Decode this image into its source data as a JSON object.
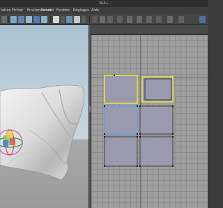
{
  "window": {
    "title": "NULL"
  },
  "menu": {
    "items": [
      {
        "id": "ration",
        "label": "ration"
      },
      {
        "id": "fichier",
        "label": "Fichier"
      },
      {
        "id": "environnement",
        "label": "Environnement"
      },
      {
        "id": "rendu",
        "label": "Rendu"
      },
      {
        "id": "fenetre",
        "label": "Fenêtre"
      },
      {
        "id": "reglages",
        "label": "Réglages"
      },
      {
        "id": "aide",
        "label": "Aide"
      }
    ]
  },
  "toolbar": {
    "icons": [
      "snap-icon",
      "rotate-icon",
      "view-icon",
      "camera-icon",
      "cube-icon",
      "grid-icon",
      "render-icon",
      "material-icon",
      "light-icon",
      "move-icon",
      "scale-icon"
    ]
  },
  "uv_editor": {
    "tools": [
      "pointer-icon",
      "select-icon",
      "move-icon",
      "scale-icon",
      "rotate-icon",
      "grid-icon",
      "snap-icon",
      "frame-icon",
      "pin-icon"
    ]
  },
  "colors": {
    "selection_yellow": "#e8e23c",
    "selection_blue": "#5aa0e8",
    "uv_face": "#9a99ad",
    "sky": "#b4c8d6"
  }
}
